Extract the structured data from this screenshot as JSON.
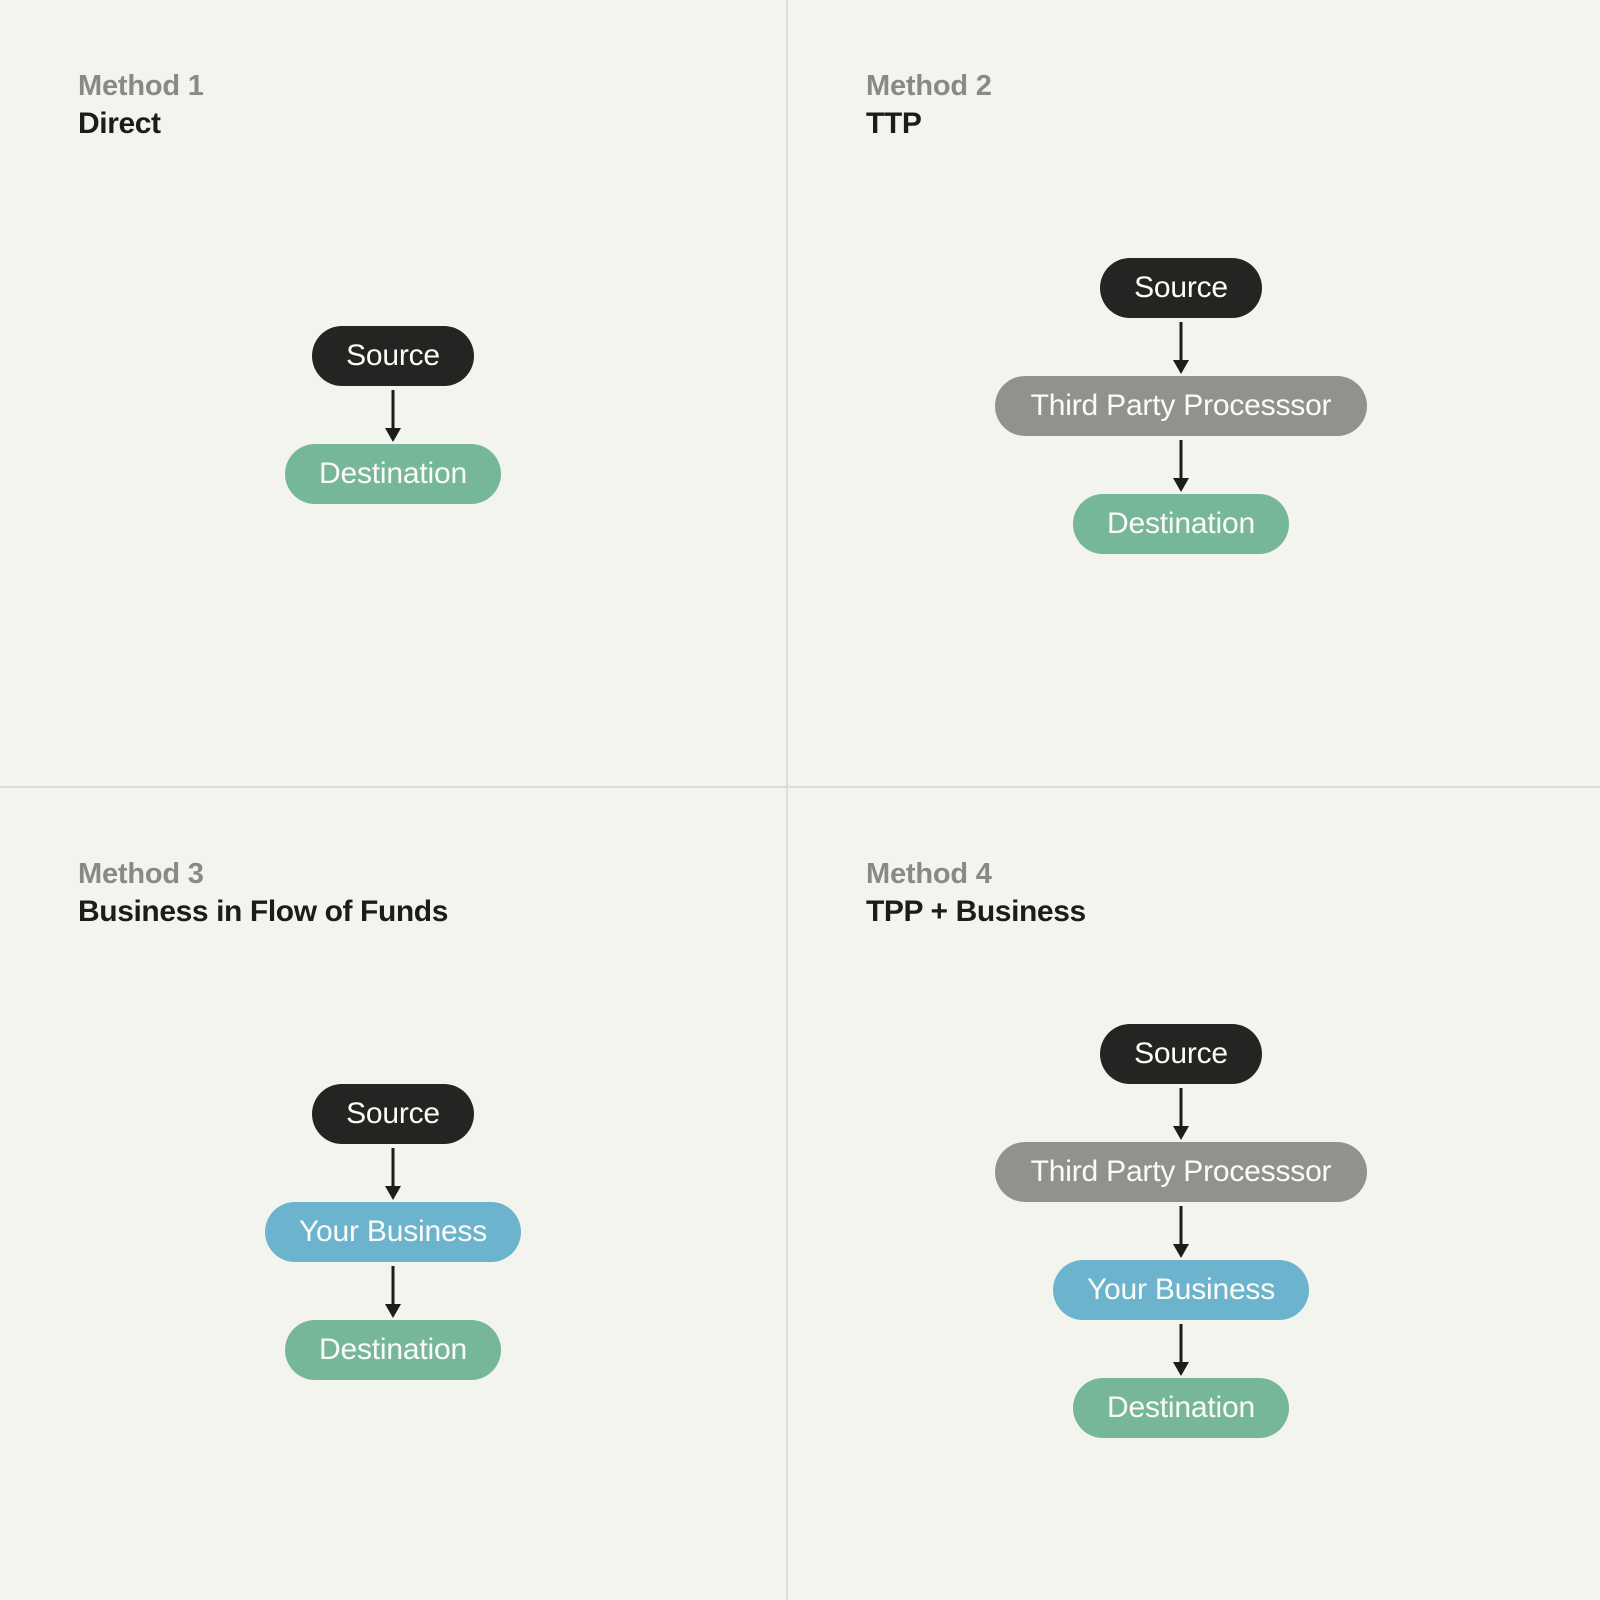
{
  "canvas": {
    "background": "#f4f4ef",
    "divider_color": "#dcdcd8"
  },
  "palette": {
    "source": "#252422",
    "third_party_processor": "#93918c",
    "your_business": "#6cb4cd",
    "destination": "#76b79a",
    "eyebrow_text": "#8a8a85",
    "title_text": "#1c1c1a",
    "node_text": "#fbfbf8",
    "arrow": "#1c1c1a"
  },
  "quadrants": [
    {
      "eyebrow": "Method 1",
      "title": "Direct",
      "nodes": [
        {
          "label": "Source",
          "role": "source"
        },
        {
          "label": "Destination",
          "role": "destination"
        }
      ]
    },
    {
      "eyebrow": "Method 2",
      "title": "TTP",
      "nodes": [
        {
          "label": "Source",
          "role": "source"
        },
        {
          "label": "Third Party Processsor",
          "role": "processor"
        },
        {
          "label": "Destination",
          "role": "destination"
        }
      ]
    },
    {
      "eyebrow": "Method 3",
      "title": "Business in Flow of Funds",
      "nodes": [
        {
          "label": "Source",
          "role": "source"
        },
        {
          "label": "Your Business",
          "role": "business"
        },
        {
          "label": "Destination",
          "role": "destination"
        }
      ]
    },
    {
      "eyebrow": "Method 4",
      "title": "TPP + Business",
      "nodes": [
        {
          "label": "Source",
          "role": "source"
        },
        {
          "label": "Third Party Processsor",
          "role": "processor"
        },
        {
          "label": "Your Business",
          "role": "business"
        },
        {
          "label": "Destination",
          "role": "destination"
        }
      ]
    }
  ]
}
